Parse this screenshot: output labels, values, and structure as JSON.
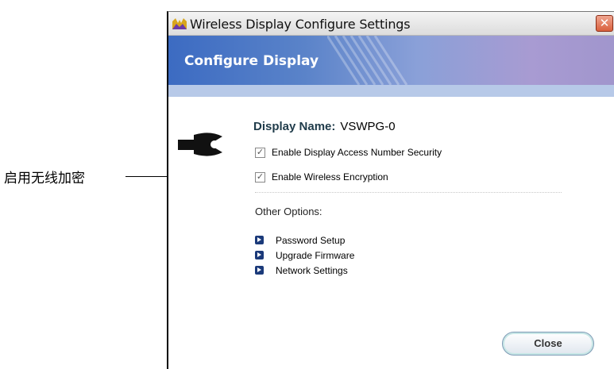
{
  "callout": {
    "label": "启用无线加密"
  },
  "window": {
    "title": "Wireless Display Configure Settings",
    "close_icon": "close-x-icon",
    "accent_color": "#3c6bc2"
  },
  "banner": {
    "title": "Configure Display"
  },
  "display": {
    "name_label": "Display Name:",
    "name_value": "VSWPG-0"
  },
  "checks": [
    {
      "label": "Enable Display Access Number Security",
      "checked": true
    },
    {
      "label": "Enable Wireless Encryption",
      "checked": true
    }
  ],
  "other_options": {
    "label": "Other Options:",
    "items": [
      {
        "label": "Password Setup",
        "icon": "arrow-right-icon"
      },
      {
        "label": "Upgrade Firmware",
        "icon": "arrow-right-icon"
      },
      {
        "label": "Network Settings",
        "icon": "arrow-right-icon"
      }
    ]
  },
  "buttons": {
    "close_label": "Close"
  }
}
